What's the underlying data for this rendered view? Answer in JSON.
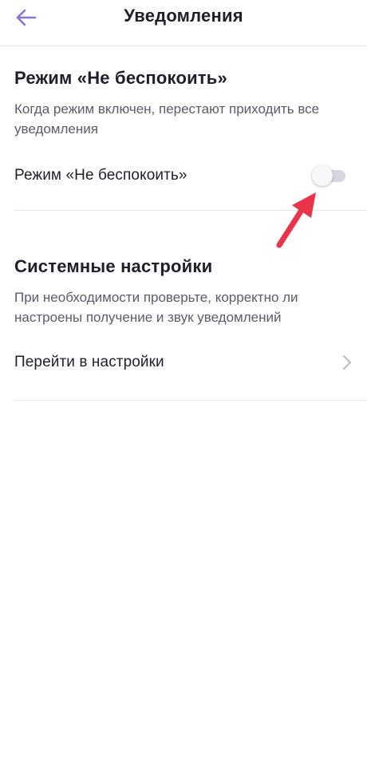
{
  "header": {
    "title": "Уведомления",
    "back_icon": "arrow-left-icon",
    "accent_color": "#8a74d6"
  },
  "dnd_section": {
    "title": "Режим «Не беспокоить»",
    "description": "Когда режим включен, перестают приходить все уведомления",
    "toggle_label": "Режим «Не беспокоить»",
    "toggle_on": false
  },
  "system_section": {
    "title": "Системные настройки",
    "description": "При необходимости проверьте, корректно ли настроены получение и звук уведомлений",
    "link_label": "Перейти в настройки",
    "link_icon": "chevron-right-icon"
  },
  "annotation": {
    "arrow_color": "#e8334a"
  }
}
